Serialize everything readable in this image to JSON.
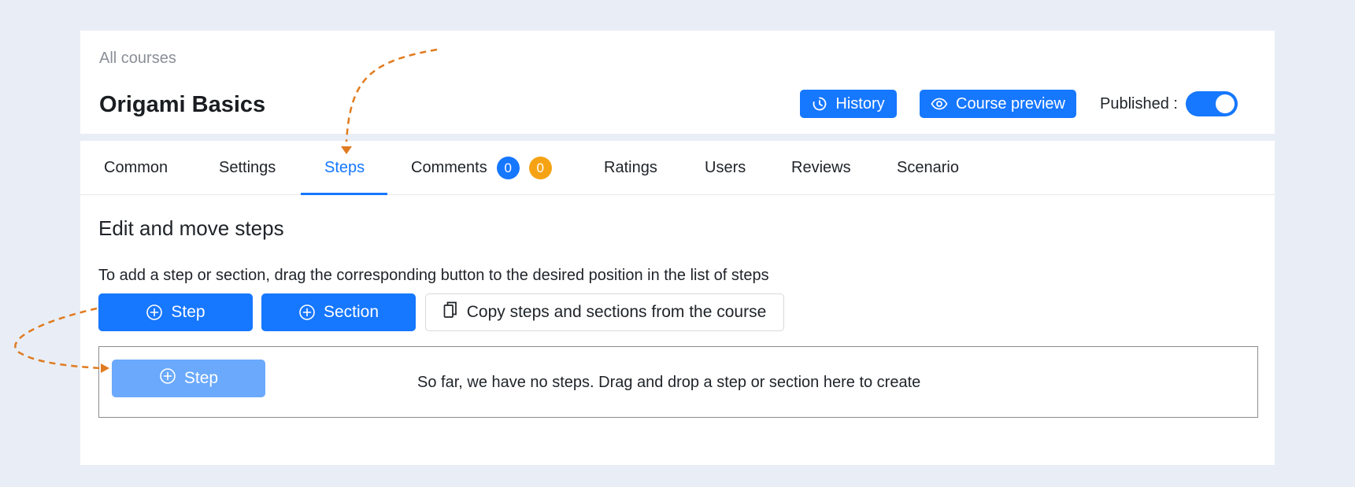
{
  "header": {
    "breadcrumb": "All courses",
    "title": "Origami Basics",
    "history_label": "History",
    "preview_label": "Course preview",
    "published_label": "Published :",
    "published": true
  },
  "tabs": [
    {
      "label": "Common",
      "active": false
    },
    {
      "label": "Settings",
      "active": false
    },
    {
      "label": "Steps",
      "active": true
    },
    {
      "label": "Comments",
      "active": false,
      "badges": [
        "0",
        "0"
      ]
    },
    {
      "label": "Ratings",
      "active": false
    },
    {
      "label": "Users",
      "active": false
    },
    {
      "label": "Reviews",
      "active": false
    },
    {
      "label": "Scenario",
      "active": false
    }
  ],
  "main": {
    "section_title": "Edit and move steps",
    "instruction": "To add a step or section, drag the corresponding button to the desired position in the list of steps",
    "step_button": "Step",
    "section_button": "Section",
    "copy_button": "Copy steps and sections from the course",
    "drop_zone": {
      "ghost_step_label": "Step",
      "empty_text": "So far, we have no steps. Drag and drop a step or section here to create"
    }
  },
  "icons": {
    "history": "clock-history-icon",
    "preview": "eye-icon",
    "add": "plus-circle-icon",
    "copy": "copy-icon"
  },
  "colors": {
    "accent": "#1677ff",
    "badge_orange": "#f5a314",
    "annotation_arrow": "#e07b1f",
    "ghost_button": "#6aa9fb",
    "background": "#e9eef6"
  }
}
